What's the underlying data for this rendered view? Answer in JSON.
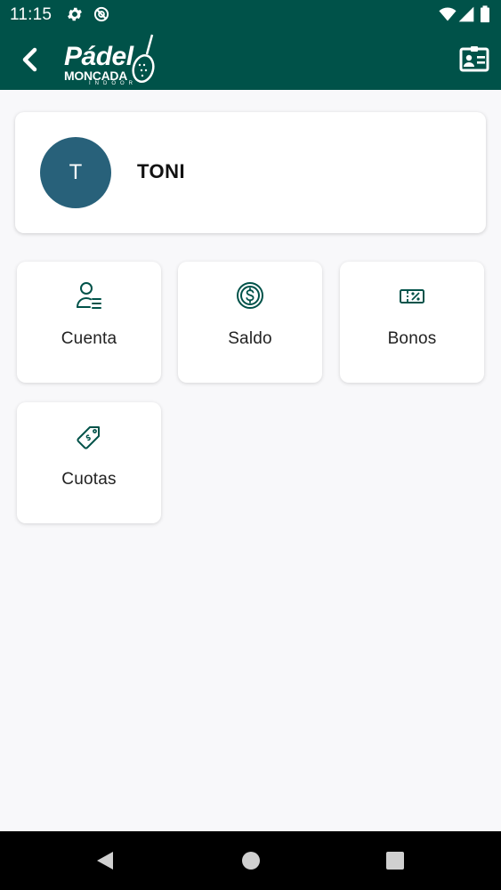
{
  "status_bar": {
    "time": "11:15",
    "icons": [
      "settings-icon",
      "no-sync-icon",
      "wifi-icon",
      "signal-icon",
      "battery-icon"
    ]
  },
  "app_bar": {
    "logo_title": "Pádel",
    "logo_subtitle": "MONCADA",
    "logo_tagline": "INDOOR",
    "back_icon": "chevron-left-icon",
    "action_icon": "id-card-icon"
  },
  "profile": {
    "initial": "T",
    "name": "TONI",
    "avatar_color": "#28617a"
  },
  "tiles": [
    {
      "label": "Cuenta",
      "icon": "user-account-icon"
    },
    {
      "label": "Saldo",
      "icon": "dollar-coin-icon"
    },
    {
      "label": "Bonos",
      "icon": "ticket-percent-icon"
    },
    {
      "label": "Cuotas",
      "icon": "price-tag-icon"
    }
  ],
  "colors": {
    "brand": "#005249",
    "icon": "#005249",
    "background": "#f8f8fa"
  },
  "nav_bar": {
    "icons": [
      "back-triangle-icon",
      "home-circle-icon",
      "recents-square-icon"
    ]
  }
}
